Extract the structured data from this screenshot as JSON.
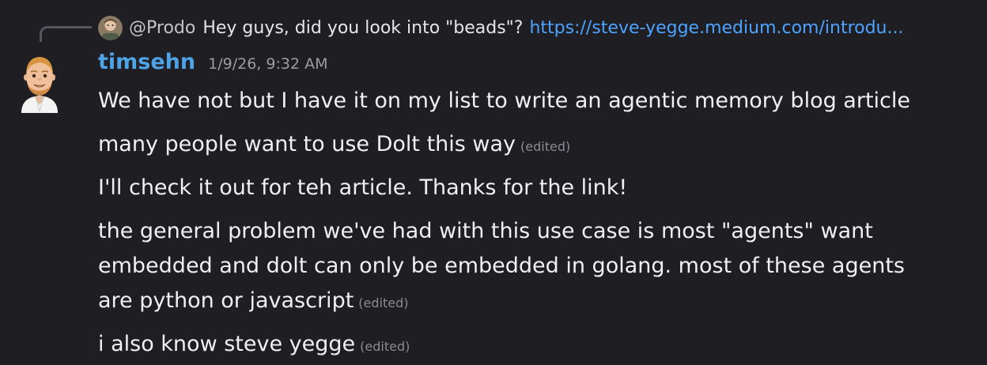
{
  "reply": {
    "author": "@Prodo",
    "text": "Hey guys, did you look into  \"beads\"?",
    "link": "https://steve-yegge.medium.com/introdu..."
  },
  "message_group": {
    "username": "timsehn",
    "timestamp": "1/9/26, 9:32 AM",
    "messages": [
      {
        "text": "We have not but I have it on my list to write an agentic memory blog article",
        "edited": ""
      },
      {
        "text": "many people want to use Dolt this way",
        "edited": "(edited)"
      },
      {
        "text": "I'll check it out for teh article. Thanks for the link!",
        "edited": ""
      },
      {
        "text": "the general problem we've had with this use case is most \"agents\" want embedded and dolt can only be embedded in golang. most of these agents are python or javascript",
        "edited": "(edited)"
      },
      {
        "text": "i also know steve yegge",
        "edited": "(edited)"
      }
    ]
  },
  "colors": {
    "background": "#1e1e23",
    "username": "#4ea3e6",
    "link": "#4da3ff",
    "timestamp": "#9c9da4"
  },
  "icons": {
    "reply_avatar": "user-avatar-icon",
    "author_avatar": "bitmoji-avatar-icon"
  }
}
